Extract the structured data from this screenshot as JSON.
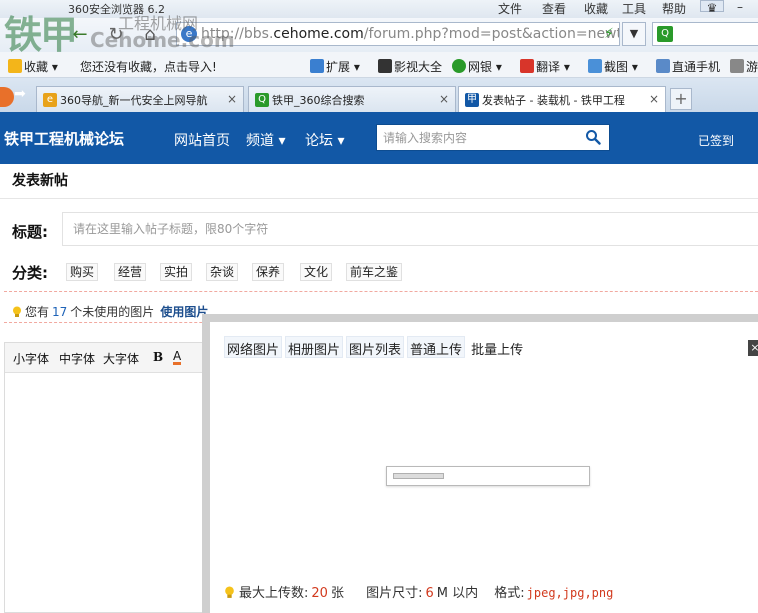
{
  "browser": {
    "app_title": "360安全浏览器 6.2",
    "menus": [
      "文件",
      "查看",
      "收藏",
      "工具",
      "帮助"
    ],
    "minimize_label": "–",
    "address_prefix": "http://bbs.",
    "address_domain": "cehome.com",
    "address_suffix": "/forum.php?mod=post&action=newth",
    "favorites": [
      {
        "label": "收藏 ▾"
      },
      {
        "label": "您还没有收藏，点击导入!"
      },
      {
        "label": "扩展 ▾"
      },
      {
        "label": "影视大全"
      },
      {
        "label": "网银 ▾"
      },
      {
        "label": "翻译 ▾"
      },
      {
        "label": "截图 ▾"
      },
      {
        "label": "直通手机"
      },
      {
        "label": "游"
      }
    ],
    "tabs": [
      {
        "label": "360导航_新一代安全上网导航"
      },
      {
        "label": "铁甲_360综合搜索"
      },
      {
        "label": "发表帖子 - 装载机 - 铁甲工程"
      }
    ],
    "tab_close": "×",
    "new_tab": "+"
  },
  "watermark": {
    "cn": "工程机械网",
    "en": "Cehome.com",
    "big": "铁甲"
  },
  "site": {
    "title": "铁甲工程机械论坛",
    "nav": [
      "网站首页",
      "频道 ▾",
      "论坛 ▾"
    ],
    "search_placeholder": "请输入搜索内容",
    "checkin": "已签到"
  },
  "post": {
    "heading": "发表新帖",
    "title_label": "标题:",
    "title_placeholder": "请在这里输入帖子标题，限80个字符",
    "category_label": "分类:",
    "categories": [
      "购买",
      "经营",
      "实拍",
      "杂谈",
      "保养",
      "文化",
      "前车之鉴"
    ],
    "tip_prefix": "您有",
    "tip_count": "17",
    "tip_suffix": "个未使用的图片",
    "tip_use": "使用图片"
  },
  "editor": {
    "tools": [
      "小字体",
      "中字体",
      "大字体",
      "B",
      "A"
    ]
  },
  "dialog": {
    "tabs": [
      "网络图片",
      "相册图片",
      "图片列表",
      "普通上传",
      "批量上传"
    ],
    "close": "×",
    "progress_fraction": 0.27,
    "max_label": "最大上传数:",
    "max_value": "20",
    "max_unit": "张",
    "size_label": "图片尺寸:",
    "size_value": "6",
    "size_unit": "M 以内",
    "format_label": "格式:",
    "format_value": "jpeg,jpg,png"
  },
  "colors": {
    "header_blue": "#1258a6",
    "accent_red": "#d23a1e",
    "link_blue": "#1e63b8"
  }
}
